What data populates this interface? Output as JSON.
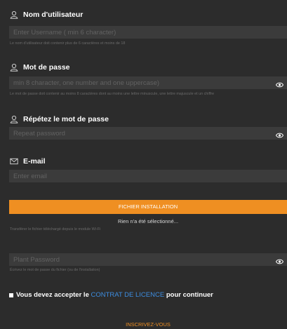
{
  "username": {
    "label": "Nom d'utilisateur",
    "placeholder": "Enter Username ( min 6 character)",
    "hint": "Le nom d'utilisateur doit contenir plus de 6 caractères et moins de 18"
  },
  "password": {
    "label": "Mot de passe",
    "placeholder": "min 8 character, one number and one uppercase)",
    "hint": "Le mot de passe doit contenir au moins 8 caractères dont au moins une lettre minuscule, une lettre majuscule et un chiffre"
  },
  "repeat_password": {
    "label": "Répétez le mot de passe",
    "placeholder": "Repeat password"
  },
  "email": {
    "label": "E-mail",
    "placeholder": "Enter email"
  },
  "file": {
    "button_label": "FICHIER INSTALLATION",
    "status": "Rien n'a été sélectionné...",
    "hint": "Transférer le fichier téléchargé depuis le module Wi-Fi"
  },
  "plant_password": {
    "placeholder": "Plant Password",
    "hint": "Écrivez le mot de passe du fichier (ou de l'installation)"
  },
  "terms": {
    "prefix": "Vous devez accepter le",
    "link": "CONTRAT DE LICENCE",
    "suffix": "pour continuer"
  },
  "submit_label": "INSCRIVEZ-VOUS",
  "colors": {
    "background": "#2c2c2c",
    "field": "#3b3b3b",
    "accent": "#ef8f22",
    "link": "#3d8de0"
  },
  "icons": {
    "username": "user-icon",
    "password": "user-icon",
    "repeat_password": "user-icon",
    "email": "envelope-icon",
    "toggle": "eye-icon"
  }
}
